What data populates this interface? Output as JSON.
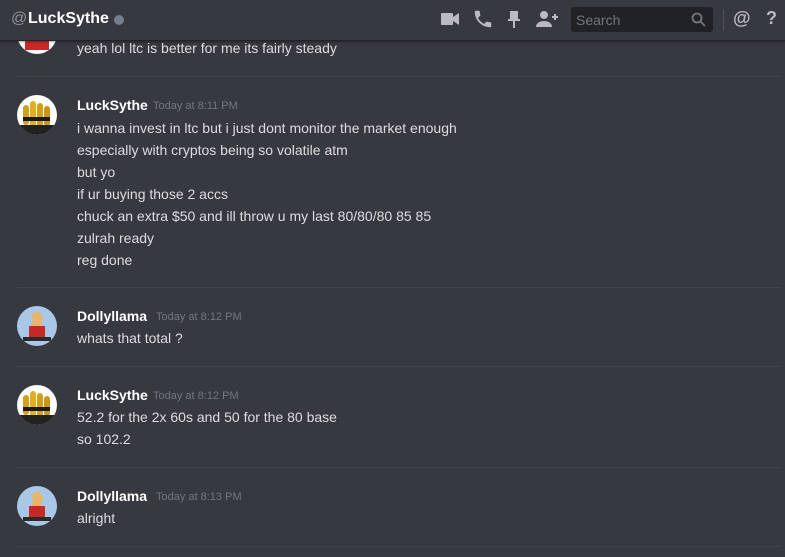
{
  "header": {
    "at_symbol": "@",
    "title": "LuckSythe",
    "search_placeholder": "Search",
    "mentions_label": "@",
    "help_label": "?"
  },
  "icons": [
    "video-call-icon",
    "voice-call-icon",
    "pin-icon",
    "add-friend-icon",
    "search-icon"
  ],
  "colors": {
    "background": "#36393f",
    "topbar_border": "#232428",
    "username": "#ffffff",
    "timestamp": "#72767d",
    "text": "#dcddde",
    "status_offline": "#747f8d"
  },
  "messages": [
    {
      "lines": [
        "yeah lol ltc is better for me its fairly steady"
      ]
    },
    {
      "author": "LuckSythe",
      "time": "Today at 8:11 PM",
      "lines": [
        "i wanna invest in ltc but i just dont monitor the market enough",
        "especially with cryptos being so volatile atm",
        "but yo",
        "if ur buying those 2 accs",
        "chuck an extra $50 and ill throw u my last 80/80/80 85 85",
        "zulrah ready",
        "reg done"
      ]
    },
    {
      "author": "Dollyllama",
      "time": "Today at 8:12 PM",
      "lines": [
        "whats that total ?"
      ]
    },
    {
      "author": "LuckSythe",
      "time": "Today at 8:12 PM",
      "lines": [
        "52.2 for the 2x 60s and 50 for the 80 base",
        "so 102.2"
      ]
    },
    {
      "author": "Dollyllama",
      "time": "Today at 8:13 PM",
      "lines": [
        "alright"
      ]
    }
  ]
}
